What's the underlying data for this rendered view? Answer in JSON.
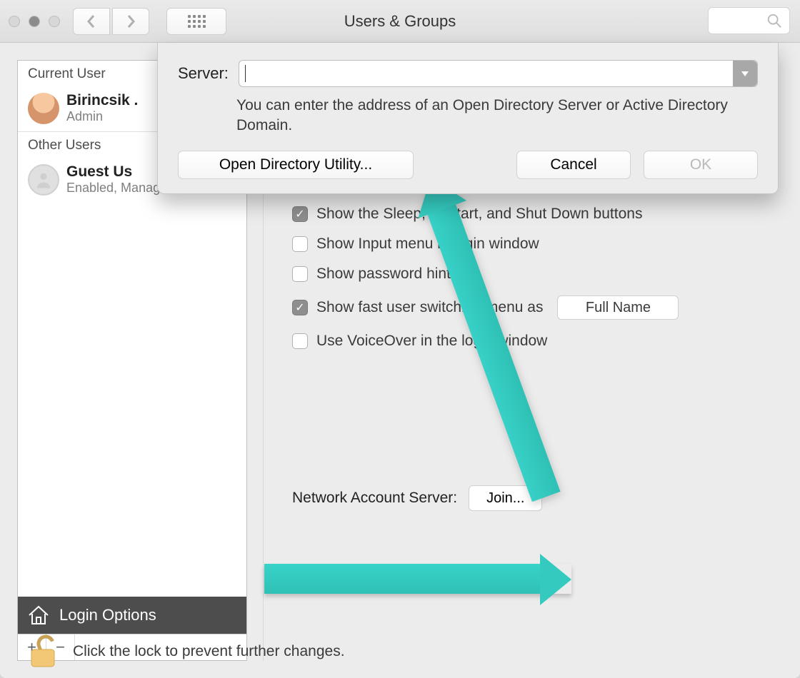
{
  "titlebar": {
    "title": "Users & Groups"
  },
  "sidebar": {
    "header_current": "Current User",
    "header_other": "Other Users",
    "current_user": {
      "name": "Birincsik .",
      "role": "Admin"
    },
    "other_user": {
      "name": "Guest Us",
      "role": "Enabled, Managed"
    },
    "login_options_label": "Login Options"
  },
  "options": {
    "sleep": "Show the Sleep, Restart, and Shut Down buttons",
    "input": "Show Input menu in login window",
    "hints": "Show password hints",
    "fastswitch": "Show fast user switching menu as",
    "fastswitch_value": "Full Name",
    "voiceover": "Use VoiceOver in the login window"
  },
  "network": {
    "label": "Network Account Server:",
    "join": "Join..."
  },
  "lock": {
    "text": "Click the lock to prevent further changes."
  },
  "sheet": {
    "server_label": "Server:",
    "help": "You can enter the address of an Open Directory Server or Active Directory Domain.",
    "open_diru": "Open Directory Utility...",
    "cancel": "Cancel",
    "ok": "OK"
  }
}
